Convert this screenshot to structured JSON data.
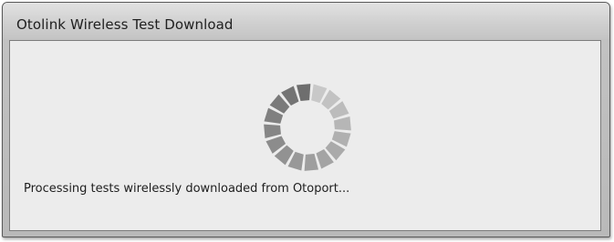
{
  "window": {
    "title": "Otolink Wireless Test Download"
  },
  "status": {
    "message": "Processing tests wirelessly downloaded from Otoport..."
  },
  "spinner": {
    "icon": "loading-spinner-icon",
    "segment_count": 16,
    "light_color": "#d8d8d8",
    "dark_color": "#6e6e6e"
  }
}
